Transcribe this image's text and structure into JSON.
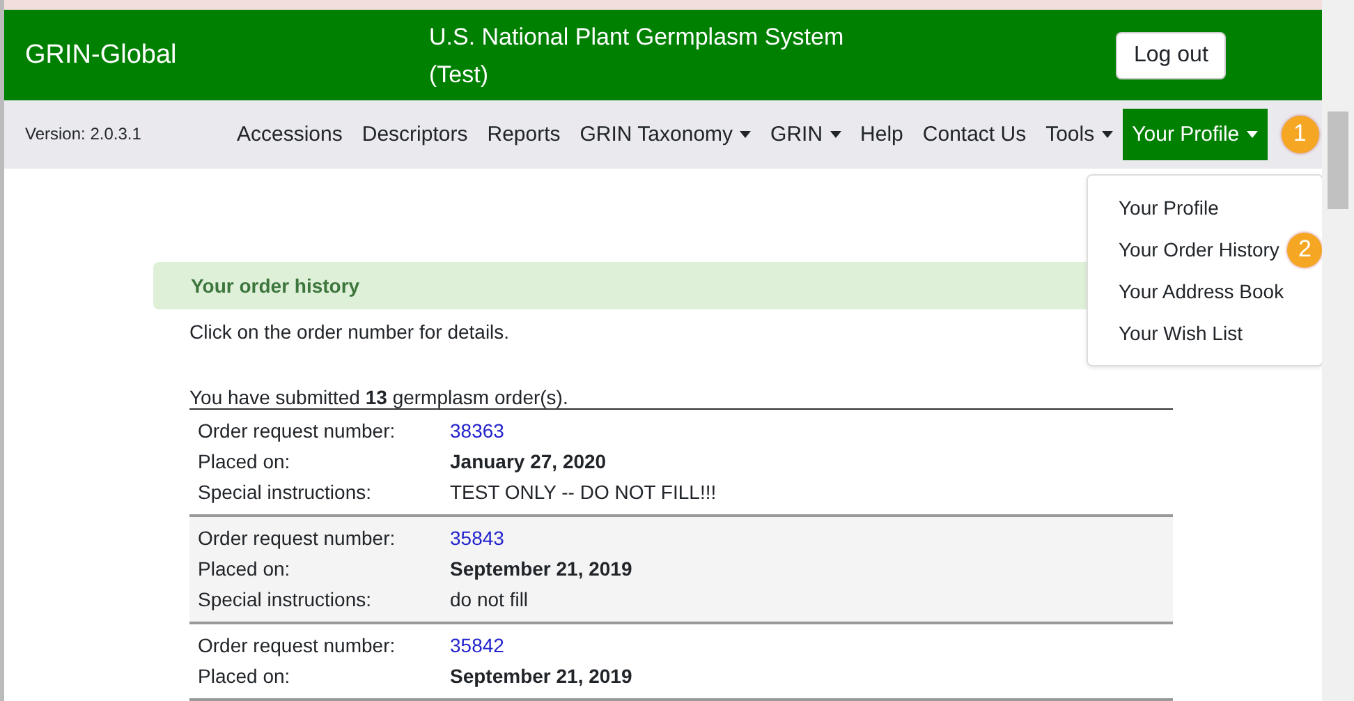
{
  "header": {
    "brand": "GRIN-Global",
    "title_lines": [
      "U.S. National Plant Germplasm System",
      "(Test)"
    ],
    "logout_button": "Log out"
  },
  "navbar": {
    "version": "Version: 2.0.3.1",
    "items": [
      {
        "label": "Accessions",
        "dropdown": false,
        "selected": false
      },
      {
        "label": "Descriptors",
        "dropdown": false,
        "selected": false
      },
      {
        "label": "Reports",
        "dropdown": false,
        "selected": false
      },
      {
        "label": "GRIN Taxonomy",
        "dropdown": true,
        "selected": false
      },
      {
        "label": "GRIN",
        "dropdown": true,
        "selected": false
      },
      {
        "label": "Help",
        "dropdown": false,
        "selected": false
      },
      {
        "label": "Contact Us",
        "dropdown": false,
        "selected": false
      },
      {
        "label": "Tools",
        "dropdown": true,
        "selected": false
      },
      {
        "label": "Your Profile",
        "dropdown": true,
        "selected": true
      }
    ]
  },
  "callouts": [
    "1",
    "2"
  ],
  "profile_menu": [
    "Your Profile",
    "Your Order History",
    "Your Address Book",
    "Your Wish List"
  ],
  "order_history": {
    "heading": "Your order history",
    "hint": "Click on the order number for details.",
    "summary": "You have submitted **13** germplasm order(s).",
    "orders": [
      {
        "fields": [
          {
            "label": "Order request number:",
            "value": "38363",
            "kind": "link"
          },
          {
            "label": "Placed on:",
            "value": "January 27, 2020",
            "kind": "bold"
          },
          {
            "label": "Special instructions:",
            "value": "TEST ONLY -- DO NOT FILL!!!",
            "kind": "plain"
          }
        ]
      },
      {
        "fields": [
          {
            "label": "Order request number:",
            "value": "35843",
            "kind": "link"
          },
          {
            "label": "Placed on:",
            "value": "September 21, 2019",
            "kind": "bold"
          },
          {
            "label": "Special instructions:",
            "value": "do not fill",
            "kind": "plain"
          }
        ]
      },
      {
        "fields": [
          {
            "label": "Order request number:",
            "value": "35842",
            "kind": "link"
          },
          {
            "label": "Placed on:",
            "value": "September 21, 2019",
            "kind": "bold"
          }
        ]
      }
    ]
  }
}
